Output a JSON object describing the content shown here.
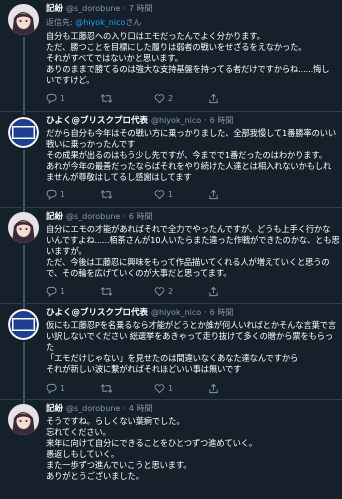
{
  "tweets": [
    {
      "name": "記紛",
      "handle": "@s_dorobune",
      "time": "7 時間",
      "reply_prefix": "返信先:",
      "reply_handle": "@hiyok_nico",
      "reply_suffix": "さん",
      "lines": [
        "自分も工藤忍への入り口はエモだったんでよく分かります。",
        "ただ、勝つことを目標にした履りは弱者の戦いをせざるをえなかった。",
        "それがすべてではないかと思います。",
        "ありのままで勝てるのは強大な支持基盤を持ってる者だけですからね......悔し",
        "いですけど。"
      ],
      "replies": "1",
      "retweets": "",
      "likes": "2",
      "avatar": "anime-character-avatar"
    },
    {
      "name": "ひよく@ブリスクプロ代表",
      "handle": "@hiyok_nico",
      "time": "6 時間",
      "lines": [
        "だから自分も今年はその戦い方に乗っかりました、全部我慢して1番勝率のいい",
        "戦いに乗っかったんです",
        "その成果が出るのはもう少し先ですが、今までで1番だったのはわかります。",
        "あれが今年の最善だったならばそれをやり続けた人達とは相入れないかもしれ",
        "ませんが尊敬はしてるし感謝はしてます"
      ],
      "replies": "1",
      "retweets": "",
      "likes": "1",
      "avatar": "brisk-logo-avatar",
      "avatar_label": "Brisk\nSquare"
    },
    {
      "name": "記紛",
      "handle": "@s_dorobune",
      "time": "6 時間",
      "lines": [
        "自分にエモの才能があればそれで全力でやったんですが、どうも上手く行かな",
        "いんですよね......栢茶さんが10人いたらまた違った作戦ができたのかな、とも思",
        "いますが。",
        "ただ、今後は工藤忍に興味をもって作品描いてくれる人が増えていくと思うの",
        "で、その輪を広げていくのが大事だと思ってます。"
      ],
      "replies": "1",
      "retweets": "",
      "likes": "2",
      "avatar": "anime-character-avatar"
    },
    {
      "name": "ひよく@ブリスクプロ代表",
      "handle": "@hiyok_nico",
      "time": "6 時間",
      "lines": [
        "仮にも工藤忍Pを名乗るなら才能がどうとか誰が何人いればとかそんな言葉で言",
        "い訳しないでください 総選挙をあきゃって走り抜けて多くの贈から票をもらっ",
        "た",
        "「エモだけじゃない」を見せたのは間違いなくあなた達なんですから",
        "それが新しい波に繋がればそれほどいい事は無いです"
      ],
      "replies": "1",
      "retweets": "",
      "likes": "1",
      "avatar": "brisk-logo-avatar",
      "avatar_label": "Brisk\nSquare"
    },
    {
      "name": "記紛",
      "handle": "@s_dorobune",
      "time": "4 時間",
      "lines": [
        "そうですね。らしくない葉痾でした。",
        "忘れてください。",
        "来年に向けて自分にできることをひとつずつ進めていく。",
        "愚返しもしていく。",
        "また一歩ずつ進んでいこうと思います。",
        "ありがとうございました。"
      ],
      "replies": "",
      "retweets": "",
      "likes": "",
      "avatar": "anime-character-avatar"
    }
  ],
  "colors": {
    "background": "#15202b",
    "muted": "#8899a6",
    "link": "#1da1f2",
    "thread_line": "#3d5466"
  }
}
